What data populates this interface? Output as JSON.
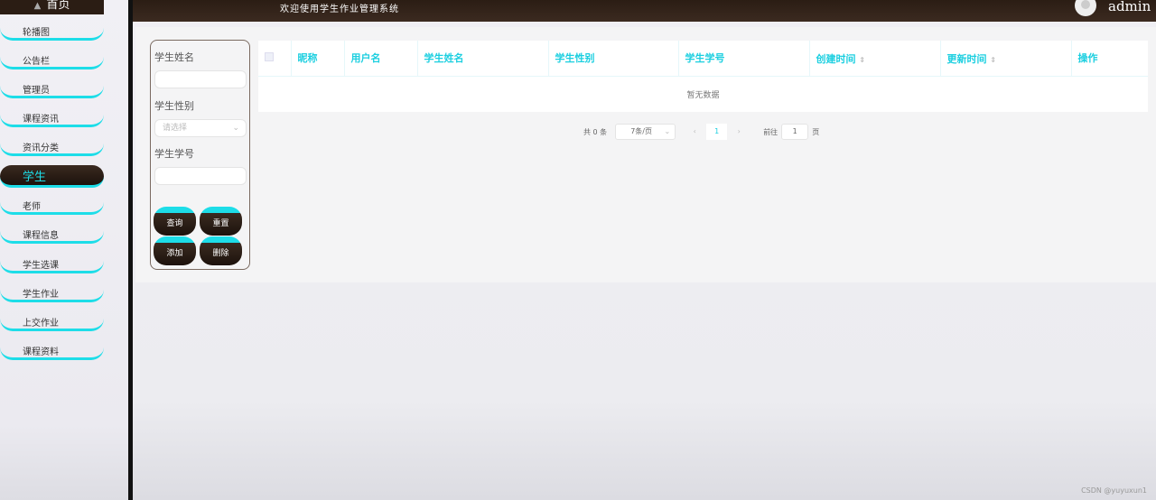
{
  "sidebar": {
    "home": "首页",
    "items": [
      "轮播图",
      "公告栏",
      "管理员",
      "课程资讯",
      "资讯分类",
      "学生",
      "老师",
      "课程信息",
      "学生选课",
      "学生作业",
      "上交作业",
      "课程资料"
    ],
    "active": "学生"
  },
  "header": {
    "welcome": "欢迎使用学生作业管理系统",
    "user": "admin"
  },
  "search": {
    "name_label": "学生姓名",
    "gender_label": "学生性别",
    "gender_placeholder": "请选择",
    "number_label": "学生学号",
    "query": "查询",
    "reset": "重置",
    "add": "添加",
    "delete": "删除"
  },
  "table": {
    "headers": [
      "昵称",
      "用户名",
      "学生姓名",
      "学生性别",
      "学生学号",
      "创建时间",
      "更新时间",
      "操作"
    ],
    "empty": "暂无数据"
  },
  "pager": {
    "total": "共 0 条",
    "page_size": "7条/页",
    "current": "1",
    "goto_label": "前往",
    "goto_value": "1",
    "page_unit": "页"
  },
  "watermark": "CSDN @yuyuxun1",
  "colors": {
    "accent": "#1ddde8",
    "dark": "#2b1d14"
  }
}
